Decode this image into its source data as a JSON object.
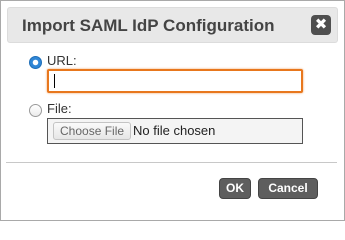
{
  "dialog": {
    "title": "Import SAML IdP Configuration",
    "close_icon": "close-icon"
  },
  "url_option": {
    "label": "URL:",
    "selected": true,
    "input_value": ""
  },
  "file_option": {
    "label": "File:",
    "selected": false,
    "choose_label": "Choose File",
    "status": "No file chosen"
  },
  "buttons": {
    "ok": "OK",
    "cancel": "Cancel"
  },
  "colors": {
    "focus_border": "#e8771d",
    "radio_selected": "#2f86d6",
    "button_bg": "#5e5e5e",
    "titlebar_bg": "#e8e8e8"
  }
}
